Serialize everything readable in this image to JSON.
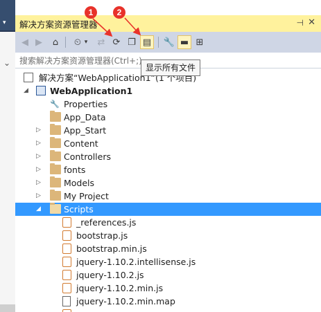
{
  "panel": {
    "title": "解决方案资源管理器",
    "pin_icon": "pin-icon",
    "close_icon": "close-icon"
  },
  "search": {
    "placeholder": "搜索解决方案资源管理器(Ctrl+;)"
  },
  "tooltip": {
    "text": "显示所有文件"
  },
  "annotations": {
    "marker1": "1",
    "marker2": "2",
    "color": "#e8322a"
  },
  "solution": {
    "label": "解决方案“WebApplication1”(1 个项目)"
  },
  "project": {
    "label": "WebApplication1"
  },
  "tree": [
    {
      "label": "Properties"
    },
    {
      "label": "App_Data"
    },
    {
      "label": "App_Start"
    },
    {
      "label": "Content"
    },
    {
      "label": "Controllers"
    },
    {
      "label": "fonts"
    },
    {
      "label": "Models"
    },
    {
      "label": "My Project"
    },
    {
      "label": "Scripts"
    },
    {
      "label": "_references.js"
    },
    {
      "label": "bootstrap.js"
    },
    {
      "label": "bootstrap.min.js"
    },
    {
      "label": "jquery-1.10.2.intellisense.js"
    },
    {
      "label": "jquery-1.10.2.js"
    },
    {
      "label": "jquery-1.10.2.min.js"
    },
    {
      "label": "jquery-1.10.2.min.map"
    }
  ],
  "colors": {
    "title_bar": "#fff29d",
    "toolbar": "#cfd6e5",
    "selection": "#3399ff",
    "folder": "#dcb67a"
  }
}
